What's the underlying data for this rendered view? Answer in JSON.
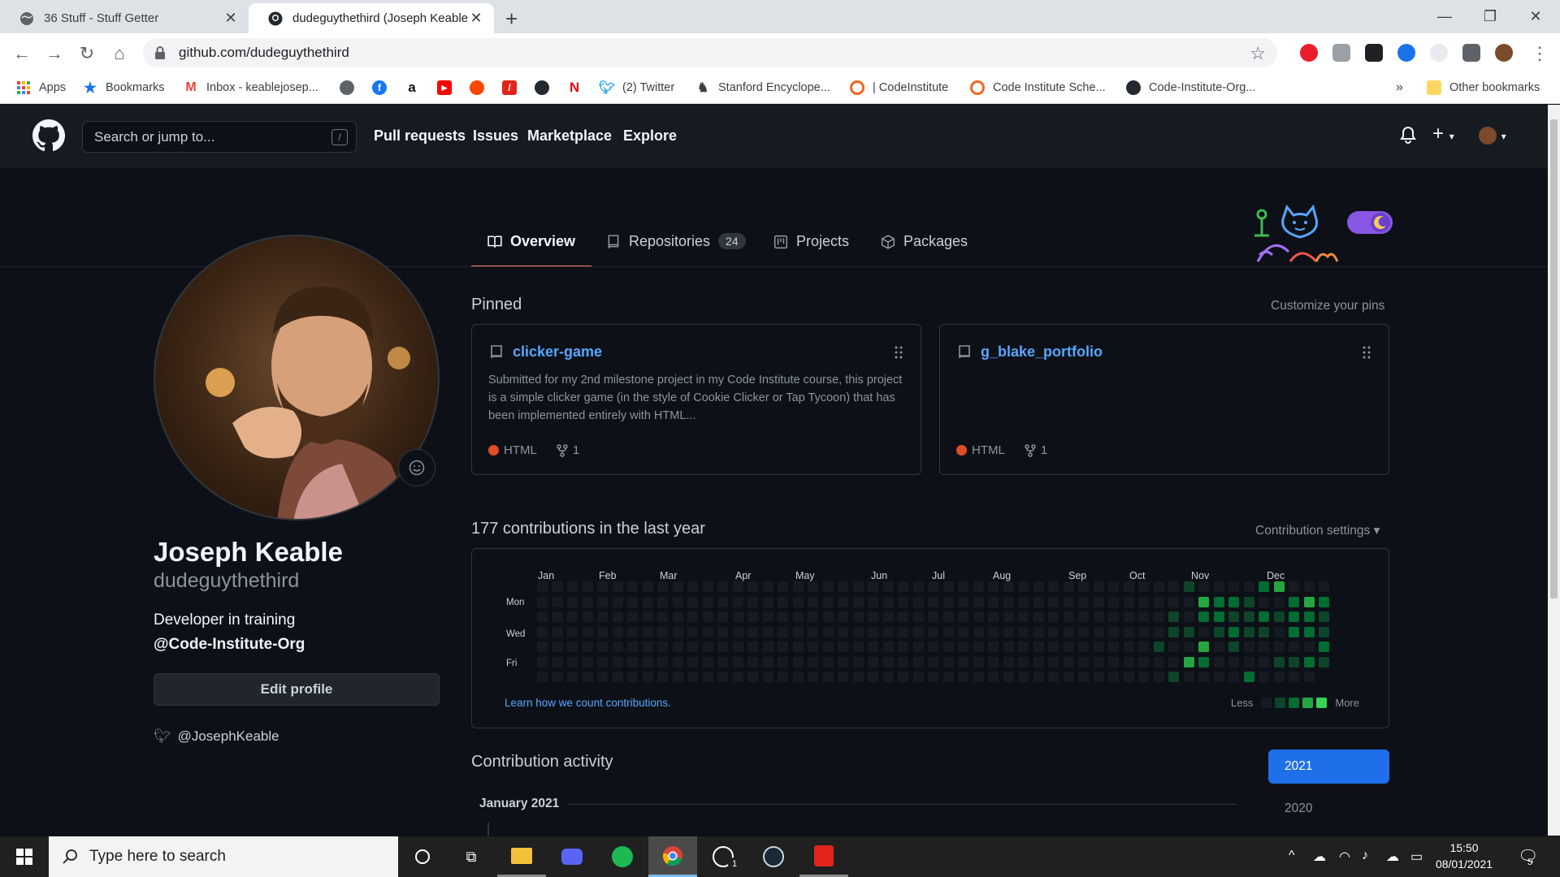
{
  "browser": {
    "tabs": [
      {
        "title": "36 Stuff - Stuff Getter",
        "active": false
      },
      {
        "title": "dudeguythethird (Joseph Keable)",
        "active": true
      }
    ],
    "url": "github.com/dudeguythethird",
    "bookmarks": [
      {
        "label": "Apps",
        "icon": "apps-grid-icon",
        "color": "#ea4335"
      },
      {
        "label": "Bookmarks",
        "icon": "star-icon",
        "color": "#1a73e8"
      },
      {
        "label": "Inbox - keablejosep...",
        "icon": "gmail-icon",
        "color": "#ea4335"
      },
      {
        "label": "",
        "icon": "owl-icon",
        "color": "#5f6368"
      },
      {
        "label": "",
        "icon": "facebook-icon",
        "color": "#1877f2"
      },
      {
        "label": "",
        "icon": "amazon-icon",
        "color": "#111111"
      },
      {
        "label": "",
        "icon": "youtube-icon",
        "color": "#ff0000"
      },
      {
        "label": "",
        "icon": "reddit-icon",
        "color": "#ff4500"
      },
      {
        "label": "",
        "icon": "slash-red-icon",
        "color": "#e1251b"
      },
      {
        "label": "",
        "icon": "circle-dark-icon",
        "color": "#24292f"
      },
      {
        "label": "",
        "icon": "netflix-icon",
        "color": "#e50914"
      },
      {
        "label": "(2) Twitter",
        "icon": "twitter-icon",
        "color": "#1da1f2"
      },
      {
        "label": "Stanford Encyclope...",
        "icon": "stanford-icon",
        "color": "#3c4043"
      },
      {
        "label": "| CodeInstitute",
        "icon": "code-institute-icon",
        "color": "#f26522"
      },
      {
        "label": "Code Institute Sche...",
        "icon": "code-institute-icon",
        "color": "#f26522"
      },
      {
        "label": "Code-Institute-Org...",
        "icon": "github-icon",
        "color": "#24292f"
      }
    ],
    "overflow": "»",
    "other_bookmarks": "Other bookmarks"
  },
  "github": {
    "search_placeholder": "Search or jump to...",
    "search_key": "/",
    "nav": [
      "Pull requests",
      "Issues",
      "Marketplace",
      "Explore"
    ],
    "profile_tabs": [
      {
        "label": "Overview",
        "icon": "book-icon",
        "active": true
      },
      {
        "label": "Repositories",
        "icon": "repo-icon",
        "count": "24"
      },
      {
        "label": "Projects",
        "icon": "project-icon"
      },
      {
        "label": "Packages",
        "icon": "package-icon"
      }
    ],
    "profile": {
      "name": "Joseph Keable",
      "login": "dudeguythethird",
      "bio": "Developer in training",
      "org": "@Code-Institute-Org",
      "edit_button": "Edit profile",
      "twitter": "@JosephKeable"
    },
    "pinned": {
      "title": "Pinned",
      "customize": "Customize your pins",
      "repos": [
        {
          "name": "clicker-game",
          "description": "Submitted for my 2nd milestone project in my Code Institute course, this project is a simple clicker game (in the style of Cookie Clicker or Tap Tycoon) that has been implemented entirely with HTML...",
          "language": "HTML",
          "language_color": "#e34c26",
          "forks": "1"
        },
        {
          "name": "g_blake_portfolio",
          "description": "",
          "language": "HTML",
          "language_color": "#e34c26",
          "forks": "1"
        }
      ]
    },
    "contributions": {
      "title": "177 contributions in the last year",
      "settings": "Contribution settings ▾",
      "months": [
        "Jan",
        "Feb",
        "Mar",
        "Apr",
        "May",
        "Jun",
        "Jul",
        "Aug",
        "Sep",
        "Oct",
        "Nov",
        "Dec"
      ],
      "day_labels": [
        "Mon",
        "Wed",
        "Fri"
      ],
      "learn_link": "Learn how we count contributions.",
      "legend_less": "Less",
      "legend_more": "More",
      "colors": [
        "#161b22",
        "#0e4429",
        "#006d32",
        "#26a641",
        "#39d353"
      ]
    },
    "activity": {
      "title": "Contribution activity",
      "month": "January 2021",
      "years": [
        "2021",
        "2020"
      ]
    }
  },
  "taskbar": {
    "search_placeholder": "Type here to search",
    "time": "15:50",
    "date": "08/01/2021",
    "notification_count": "5",
    "xbox_badge": "1",
    "apps": [
      "cortana-icon",
      "task-view-icon",
      "file-explorer-icon",
      "discord-icon",
      "spotify-icon",
      "chrome-icon",
      "xbox-icon",
      "steam-icon",
      "acrobat-icon"
    ]
  }
}
